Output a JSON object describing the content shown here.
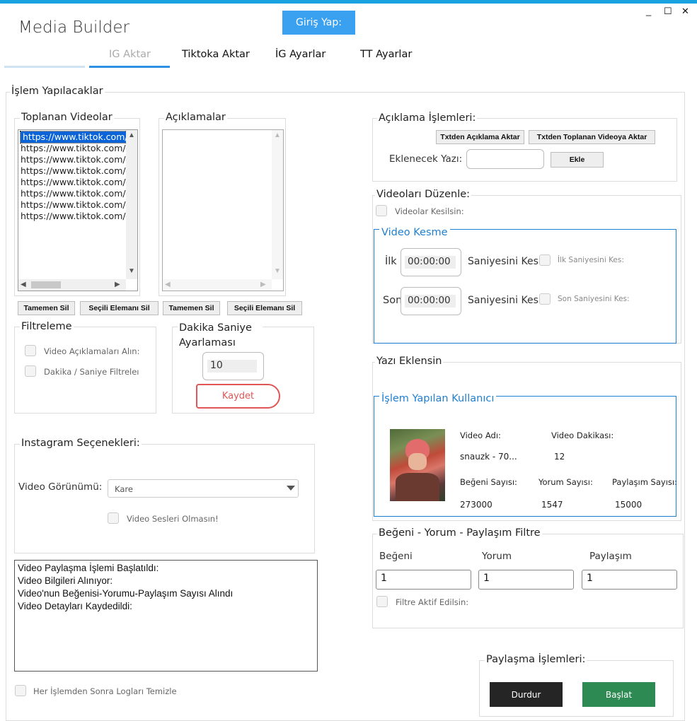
{
  "window": {
    "title": "Media Builder",
    "login_button": "Giriş Yap:",
    "controls": {
      "minimize": "_",
      "maximize": "☐",
      "close": "✕"
    }
  },
  "tabs": [
    {
      "label": "IG Aktar",
      "active": true
    },
    {
      "label": "Tiktoka Aktar"
    },
    {
      "label": "İG Ayarlar"
    },
    {
      "label": "TT Ayarlar"
    }
  ],
  "main_group": {
    "title": "İşlem Yapılacaklar"
  },
  "collected_videos": {
    "title": "Toplanan Videolar",
    "items": [
      "https://www.tiktok.com/@",
      "https://www.tiktok.com/@",
      "https://www.tiktok.com/@",
      "https://www.tiktok.com/@",
      "https://www.tiktok.com/@",
      "https://www.tiktok.com/@",
      "https://www.tiktok.com/@",
      "https://www.tiktok.com/@"
    ],
    "delete_all": "Tamemen Sil",
    "delete_selected": "Seçili Elemanı Sil"
  },
  "descriptions": {
    "title": "Açıklamalar",
    "delete_all": "Tamemen Sil",
    "delete_selected": "Seçili Elemanı Sil"
  },
  "filter": {
    "title": "Filtreleme",
    "get_descriptions": "Video Açıklamaları Alın:",
    "minute_second_filter": "Dakika / Saniye Filtreleı"
  },
  "minute_setting": {
    "title": "Dakika Saniye Ayarlaması",
    "value": "10",
    "save": "Kaydet"
  },
  "instagram_options": {
    "title": "Instagram Seçenekleri:",
    "view_label": "Video Görünümü:",
    "view_value": "Kare",
    "no_sound": "Video Sesleri Olmasın!"
  },
  "log": {
    "lines": [
      "Video Paylaşma İşlemi Başlatıldı:",
      "Video Bilgileri Alınıyor:",
      "Video'nun Beğenisi-Yorumu-Paylaşım Sayısı Alındı",
      "Video Detayları Kaydedildi:"
    ],
    "clear_after": "Her İşlemden Sonra Logları Temizle"
  },
  "description_ops": {
    "title": "Açıklama İşlemleri:",
    "from_txt": "Txtden Açıklama Aktar",
    "from_txt_videos": "Txtden Toplanan Videoya Aktar",
    "text_label": "Eklenecek Yazı:",
    "text_value": "",
    "add": "Ekle"
  },
  "edit_videos": {
    "title": "Videoları Düzenle:",
    "cut_videos": "Videolar Kesilsin:",
    "cut_group": {
      "title": "Video Kesme",
      "first_label": "İlk",
      "first_value": "00:00:00",
      "first_suffix": "Saniyesini Kes",
      "first_check": "İlk Saniyesini Kes:",
      "last_label": "Son",
      "last_value": "00:00:00",
      "last_suffix": "Saniyesini Kes",
      "last_check": "Son Saniyesini Kes:"
    }
  },
  "add_text": {
    "title": "Yazı Eklensin"
  },
  "current_user": {
    "title": "İşlem Yapılan Kullanıcı",
    "video_name_label": "Video Adı:",
    "video_name": "snauzk - 70...",
    "video_minute_label": "Video Dakikası:",
    "video_minute": "12",
    "likes_label": "Beğeni Sayısı:",
    "likes": "273000",
    "comments_label": "Yorum Sayısı:",
    "comments": "1547",
    "shares_label": "Paylaşım Sayısı:",
    "shares": "15000"
  },
  "engagement_filter": {
    "title": "Beğeni - Yorum - Paylaşım Filtre",
    "likes_label": "Beğeni",
    "likes_value": "1",
    "comments_label": "Yorum",
    "comments_value": "1",
    "shares_label": "Paylaşım",
    "shares_value": "1",
    "filter_active": "Filtre Aktif Edilsin:"
  },
  "share_ops": {
    "title": "Paylaşma İşlemleri:",
    "stop": "Durdur",
    "start": "Başlat"
  },
  "colors": {
    "accent": "#1aa3e0",
    "login": "#3aa0f0",
    "group_blue": "#1f7fd0",
    "save_red": "#e05555",
    "stop": "#252525",
    "start": "#2c8a52"
  }
}
